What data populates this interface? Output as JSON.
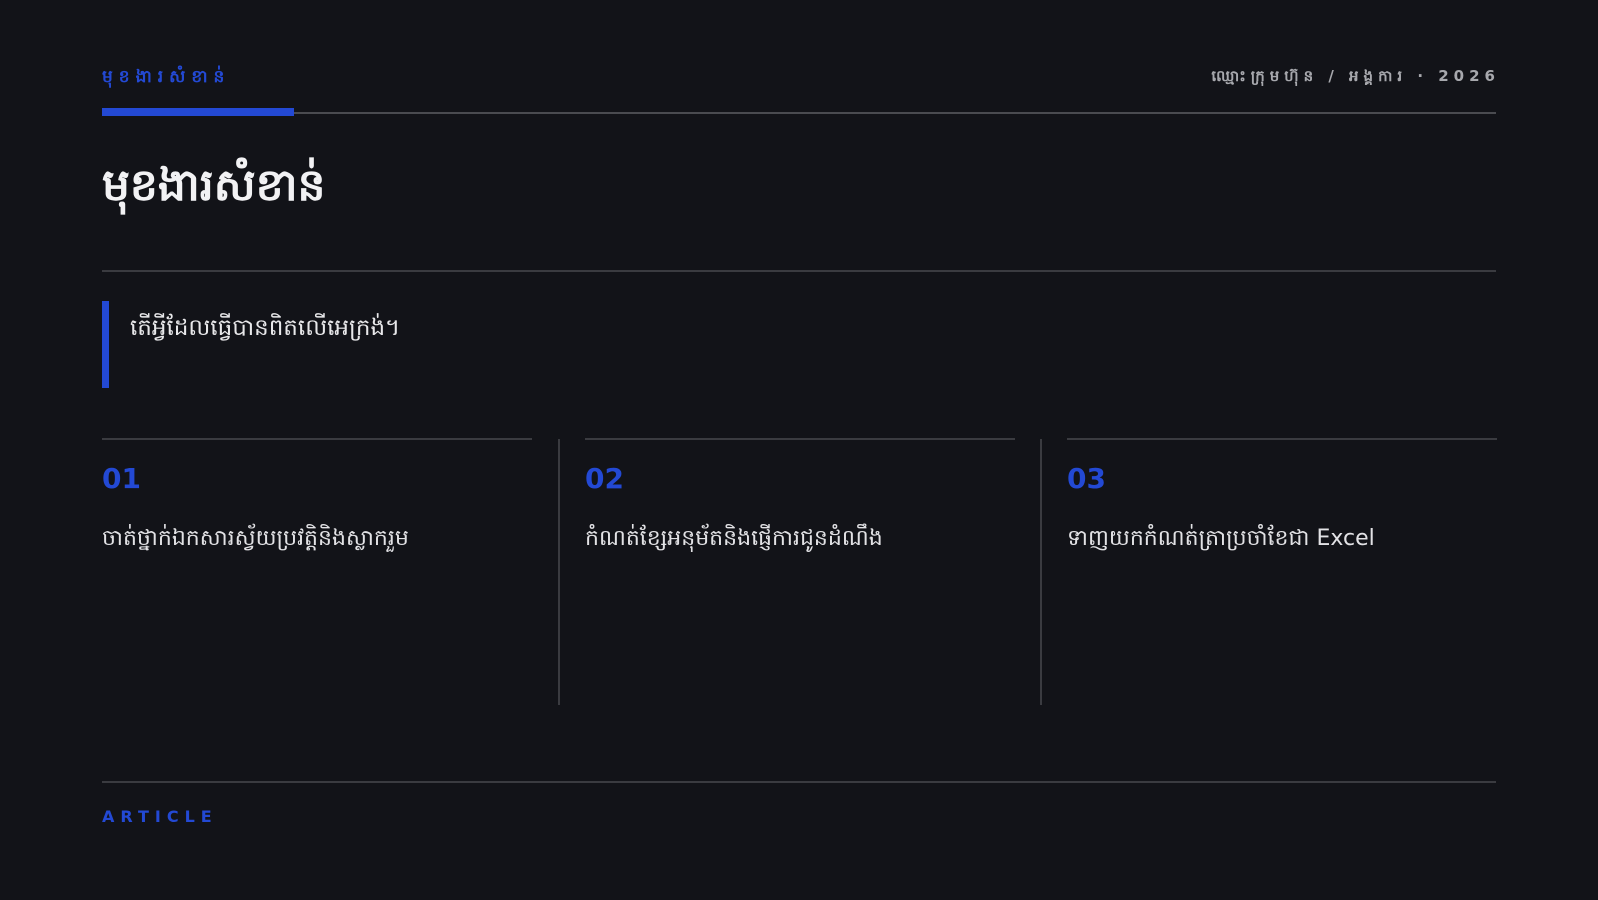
{
  "header": {
    "eyebrow": "មុខងារសំខាន់",
    "meta": "ឈ្មោះក្រុមហ៊ុន / អង្គការ · 2026"
  },
  "title": "មុខងារសំខាន់",
  "quote": "តើអ្វីដែលធ្វើបានពិតលើអេក្រង់។",
  "features": [
    {
      "number": "01",
      "text": "ចាត់ថ្នាក់ឯកសារស្វ័យប្រវត្តិនិងស្លាករួម"
    },
    {
      "number": "02",
      "text": "កំណត់ខ្សែអនុម័តនិងផ្ញើការជូនដំណឹង"
    },
    {
      "number": "03",
      "text": "ទាញយកកំណត់ត្រាប្រចាំខែជា Excel"
    }
  ],
  "footer": {
    "label": "ARTICLE"
  },
  "colors": {
    "background": "#121318",
    "accent": "#2349d4",
    "text": "#ececee",
    "muted": "#a7a8ad",
    "rule": "#3a3b40"
  }
}
